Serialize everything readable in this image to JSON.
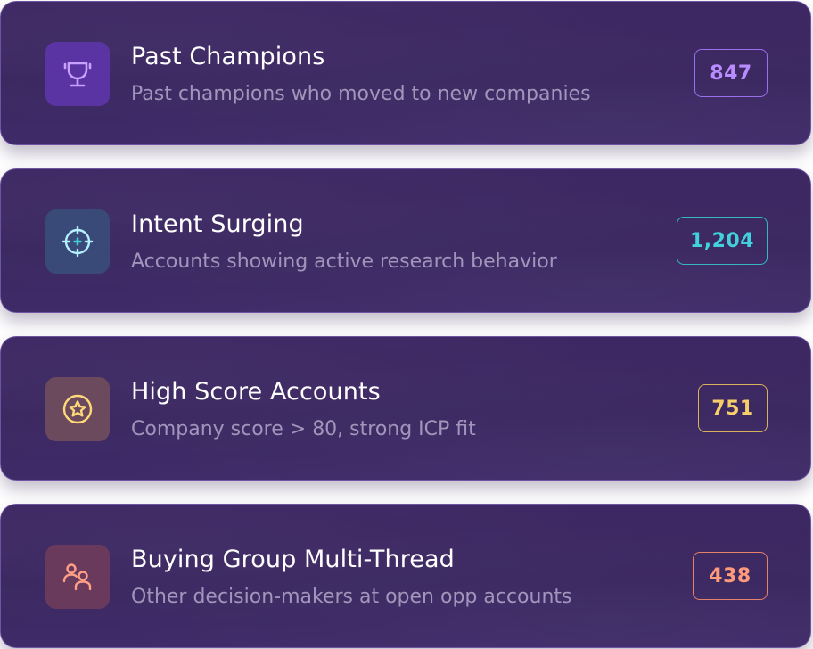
{
  "segments": [
    {
      "title": "Past Champions",
      "description": "Past champions who moved to new companies",
      "count": "847",
      "icon": "trophy-icon",
      "accent": "#b98cff",
      "icon_bg": "#5b34a3"
    },
    {
      "title": "Intent Surging",
      "description": "Accounts showing active research behavior",
      "count": "1,204",
      "icon": "crosshair-icon",
      "accent": "#41d1db",
      "icon_bg": "#3a4a78"
    },
    {
      "title": "High Score Accounts",
      "description": "Company score > 80, strong ICP fit",
      "count": "751",
      "icon": "star-badge-icon",
      "accent": "#f7cf6a",
      "icon_bg": "#6b4a5e"
    },
    {
      "title": "Buying Group Multi-Thread",
      "description": "Other decision-makers at open opp accounts",
      "count": "438",
      "icon": "users-icon",
      "accent": "#ff9a7a",
      "icon_bg": "#6a3a5c"
    }
  ]
}
